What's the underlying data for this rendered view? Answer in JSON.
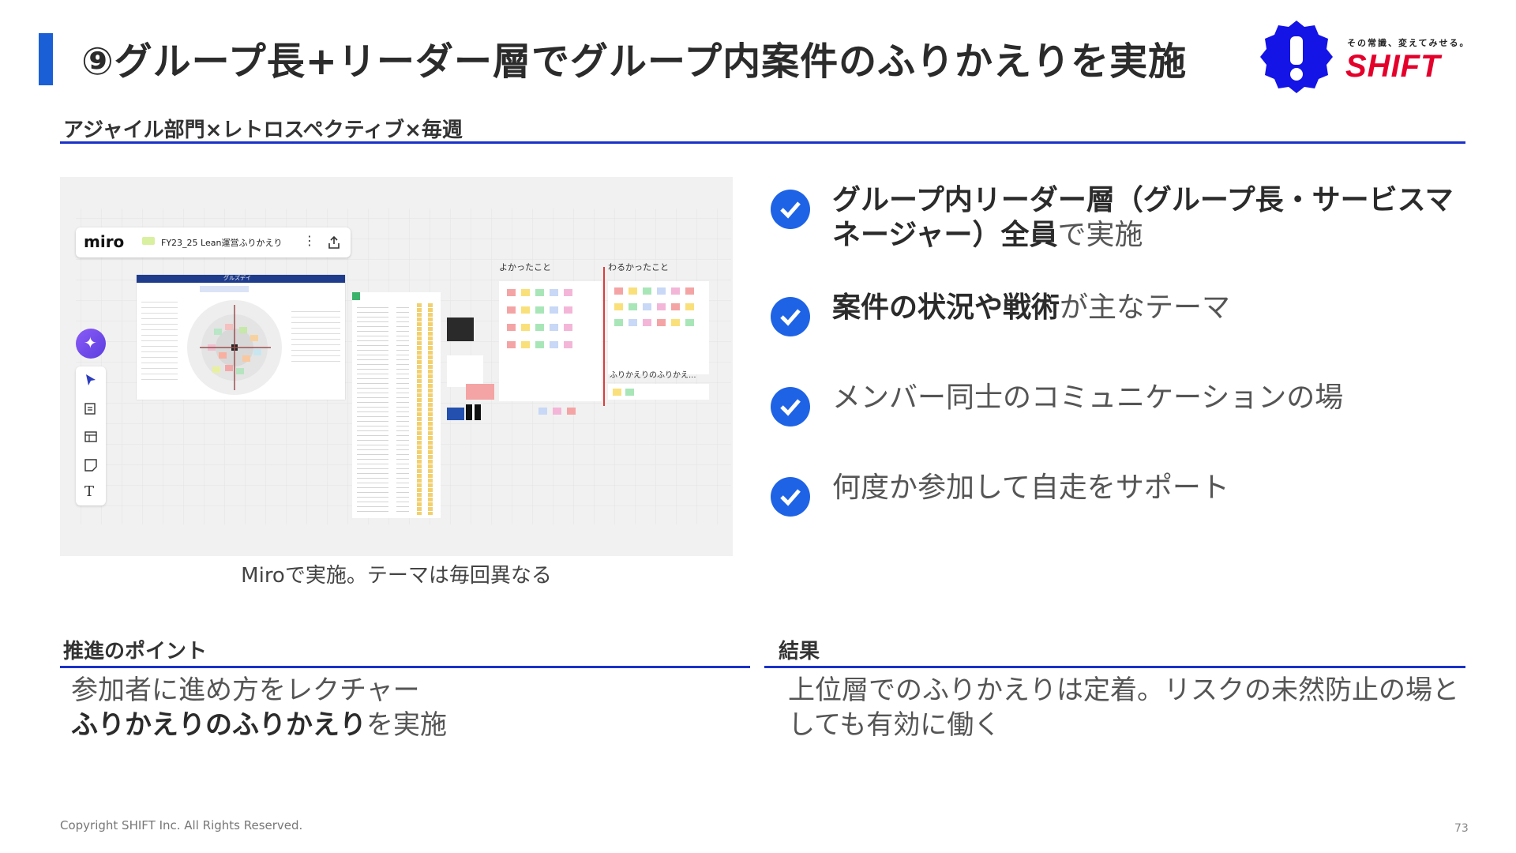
{
  "slide": {
    "title": "⑨グループ長+リーダー層でグループ内案件のふりかえりを実施",
    "subtitle": "アジャイル部門×レトロスペクティブ×毎週",
    "logo": {
      "tagline": "その常識、変えてみせる。",
      "brand": "SHIFT",
      "brand_color": "#e4002b",
      "mark_color": "#1414e6"
    },
    "accent_color": "#1a5fd6",
    "rule_color": "#1a32c8"
  },
  "screenshot": {
    "app_name": "miro",
    "board_title": "FY23_25 Lean運営ふりかえり",
    "board_header": "グルズデイ",
    "column_good": "よかったこと",
    "column_bad": "わるかったこと",
    "frame_label": "ふりかえりのふりかえ...",
    "caption": "Miroで実施。テーマは毎回異なる"
  },
  "bullets": [
    {
      "bold": "グループ内リーダー層（グループ長・サービスマネージャー）全員",
      "rest": "で実施"
    },
    {
      "bold": "案件の状況や戦術",
      "rest": "が主なテーマ"
    },
    {
      "bold": "",
      "rest": "メンバー同士のコミュニケーションの場"
    },
    {
      "bold": "",
      "rest": "何度か参加して自走をサポート"
    }
  ],
  "points": {
    "heading": "推進のポイント",
    "line1": "参加者に進め方をレクチャー",
    "line2_bold": "ふりかえりのふりかえり",
    "line2_rest": "を実施"
  },
  "results": {
    "heading": "結果",
    "text": "上位層でのふりかえりは定着。リスクの未然防止の場としても有効に働く"
  },
  "footer": {
    "copyright": "Copyright SHIFT Inc. All Rights Reserved.",
    "page_number": "73"
  }
}
